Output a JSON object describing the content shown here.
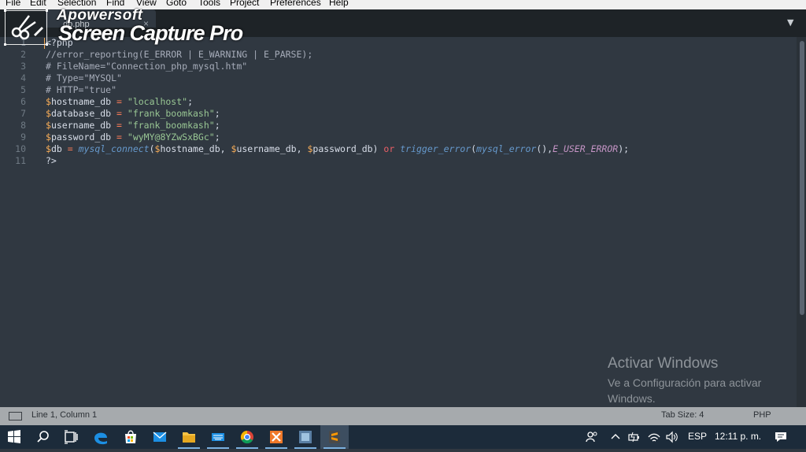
{
  "menu": [
    "File",
    "Edit",
    "Selection",
    "Find",
    "View",
    "Goto",
    "Tools",
    "Project",
    "Preferences",
    "Help"
  ],
  "tab": {
    "filename": "db.php",
    "close": "×",
    "dropdown": "▼"
  },
  "watermark": {
    "brand": "Apowersoft",
    "product": "Screen Capture Pro"
  },
  "code_lines": [
    {
      "n": "1",
      "tokens": [
        {
          "t": "<?php",
          "c": "txt"
        }
      ]
    },
    {
      "n": "2",
      "tokens": [
        {
          "t": "//error_reporting(E_ERROR | E_WARNING | E_PARSE);",
          "c": "cm"
        }
      ]
    },
    {
      "n": "3",
      "tokens": [
        {
          "t": "# FileName=\"Connection_php_mysql.htm\"",
          "c": "cm"
        }
      ]
    },
    {
      "n": "4",
      "tokens": [
        {
          "t": "# Type=\"MYSQL\"",
          "c": "cm"
        }
      ]
    },
    {
      "n": "5",
      "tokens": [
        {
          "t": "# HTTP=\"true\"",
          "c": "cm"
        }
      ]
    },
    {
      "n": "6",
      "tokens": [
        {
          "t": "$",
          "c": "var"
        },
        {
          "t": "hostname_db ",
          "c": "txt"
        },
        {
          "t": "=",
          "c": "op"
        },
        {
          "t": " ",
          "c": "txt"
        },
        {
          "t": "\"localhost\"",
          "c": "str"
        },
        {
          "t": ";",
          "c": "txt"
        }
      ]
    },
    {
      "n": "7",
      "tokens": [
        {
          "t": "$",
          "c": "var"
        },
        {
          "t": "database_db ",
          "c": "txt"
        },
        {
          "t": "=",
          "c": "op"
        },
        {
          "t": " ",
          "c": "txt"
        },
        {
          "t": "\"frank_boomkash\"",
          "c": "str"
        },
        {
          "t": ";",
          "c": "txt"
        }
      ]
    },
    {
      "n": "8",
      "tokens": [
        {
          "t": "$",
          "c": "var"
        },
        {
          "t": "username_db ",
          "c": "txt"
        },
        {
          "t": "=",
          "c": "op"
        },
        {
          "t": " ",
          "c": "txt"
        },
        {
          "t": "\"frank_boomkash\"",
          "c": "str"
        },
        {
          "t": ";",
          "c": "txt"
        }
      ]
    },
    {
      "n": "9",
      "tokens": [
        {
          "t": "$",
          "c": "var"
        },
        {
          "t": "password_db ",
          "c": "txt"
        },
        {
          "t": "=",
          "c": "op"
        },
        {
          "t": " ",
          "c": "txt"
        },
        {
          "t": "\"wyMY@8YZwSxBGc\"",
          "c": "str"
        },
        {
          "t": ";",
          "c": "txt"
        }
      ]
    },
    {
      "n": "10",
      "tokens": [
        {
          "t": "$",
          "c": "var"
        },
        {
          "t": "db ",
          "c": "txt"
        },
        {
          "t": "=",
          "c": "op"
        },
        {
          "t": " ",
          "c": "txt"
        },
        {
          "t": "mysql_connect",
          "c": "fn2"
        },
        {
          "t": "(",
          "c": "txt"
        },
        {
          "t": "$",
          "c": "var"
        },
        {
          "t": "hostname_db, ",
          "c": "txt"
        },
        {
          "t": "$",
          "c": "var"
        },
        {
          "t": "username_db, ",
          "c": "txt"
        },
        {
          "t": "$",
          "c": "var"
        },
        {
          "t": "password_db) ",
          "c": "txt"
        },
        {
          "t": "or",
          "c": "kw"
        },
        {
          "t": " ",
          "c": "txt"
        },
        {
          "t": "trigger_error",
          "c": "fn2"
        },
        {
          "t": "(",
          "c": "txt"
        },
        {
          "t": "mysql_error",
          "c": "fn2"
        },
        {
          "t": "(),",
          "c": "txt"
        },
        {
          "t": "E_USER_ERROR",
          "c": "const"
        },
        {
          "t": ");",
          "c": "txt"
        }
      ]
    },
    {
      "n": "11",
      "tokens": [
        {
          "t": "?>",
          "c": "txt"
        }
      ]
    }
  ],
  "activation": {
    "title": "Activar Windows",
    "subtitle": "Ve a Configuración para activar Windows."
  },
  "status": {
    "position": "Line 1, Column 1",
    "tab_size": "Tab Size: 4",
    "syntax": "PHP"
  },
  "taskbar": {
    "apps": [
      "start-icon",
      "search-icon",
      "task-view-icon",
      "edge-icon",
      "store-icon",
      "mail-icon",
      "file-explorer-icon",
      "keyboard-icon",
      "chrome-icon",
      "xampp-icon",
      "app-icon",
      "sublime-text-icon"
    ],
    "tray": {
      "language": "ESP",
      "time": "12:11 p. m."
    }
  }
}
